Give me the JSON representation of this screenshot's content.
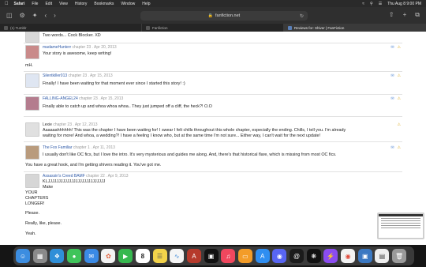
{
  "menubar": {
    "apple": "",
    "items": [
      "Safari",
      "File",
      "Edit",
      "View",
      "History",
      "Bookmarks",
      "Window",
      "Help"
    ],
    "datetime": "Thu Aug 8  9:00 PM"
  },
  "toolbar": {
    "url": "fanfiction.net"
  },
  "tabs": [
    {
      "label": "(1) Tumblr"
    },
    {
      "label": "Fanfiction"
    },
    {
      "label": "Reviews for: Shiver | FanFiction"
    }
  ],
  "reviews": [
    {
      "name": "",
      "meta": "",
      "body": "Two words... Cock Blocker. XD",
      "extra": ""
    },
    {
      "name": "madameHunterr",
      "meta": "chapter 23 . Apr 20, 2013",
      "body": "Your story is awesome, keep writing!",
      "extra": "mH."
    },
    {
      "name": "Silentkiller013",
      "meta": "chapter 23 . Apr 15, 2013",
      "body": "Finally! I have been waiting for that moment ever since I started this story! :)",
      "extra": ""
    },
    {
      "name": "FALLING-ANGEL24",
      "meta": "chapter 23 . Apr 15, 2013",
      "body": "Finally able to catch up and whoa whoa whoa.. They just jumped off a cliff, the heck?! O.O",
      "extra": ""
    },
    {
      "name": "Lexie",
      "meta": "chapter 23 . Apr 12, 2013",
      "body": "Aaaaaahhhhhh! This was the chapter I have been waiting for! I swear I felt chills throughout this whole chapter, especially the ending. Chills, I tell you. I'm already",
      "body2": "waiting for more! And whoa, a wedding?! I have a feeling I know who, but at the same time I'm not sure... Either way, I can't wait for the next update!",
      "extra": ""
    },
    {
      "name": "The Fox Familiar",
      "meta": "chapter 1 . Apr 11, 2013",
      "body": "I usually don't like OC fics, but I love the intro. It's very mysterious and guides me along. And, there's that historical flare, which is missing from most OC fics.",
      "extra": "You have a great hook, and I'm getting shivers reading it. You've got me."
    },
    {
      "name": "Assassin's Creed BAMF",
      "meta": "chapter 22 . Apr 9, 2013",
      "body": "KLJJJJJJJJJJJJJJJJJJJJJJJJJJJ",
      "body2": "Make",
      "lines": [
        "YOUR",
        "CHAPTERS",
        "LONGER!",
        "",
        "Please.",
        "",
        "Really, like, please.",
        "",
        "Yeah."
      ]
    }
  ],
  "dock": {
    "apps": [
      "finder-icon",
      "launchpad-icon",
      "safari-icon",
      "messages-icon",
      "mail-icon",
      "photos-icon",
      "facetime-icon",
      "calendar-icon",
      "notes-icon",
      "freeform-icon",
      "dictionary-icon",
      "appletv-icon",
      "music-icon",
      "books-icon",
      "appstore-icon",
      "discord-icon",
      "threads-icon",
      "chatgpt-icon",
      "messenger-icon",
      "chrome-icon",
      "preview-icon",
      "document-icon",
      "trash-icon"
    ],
    "calendar_day": "8"
  },
  "colors": {
    "link": "#2f5aa8",
    "flag": "#e0b43a"
  }
}
